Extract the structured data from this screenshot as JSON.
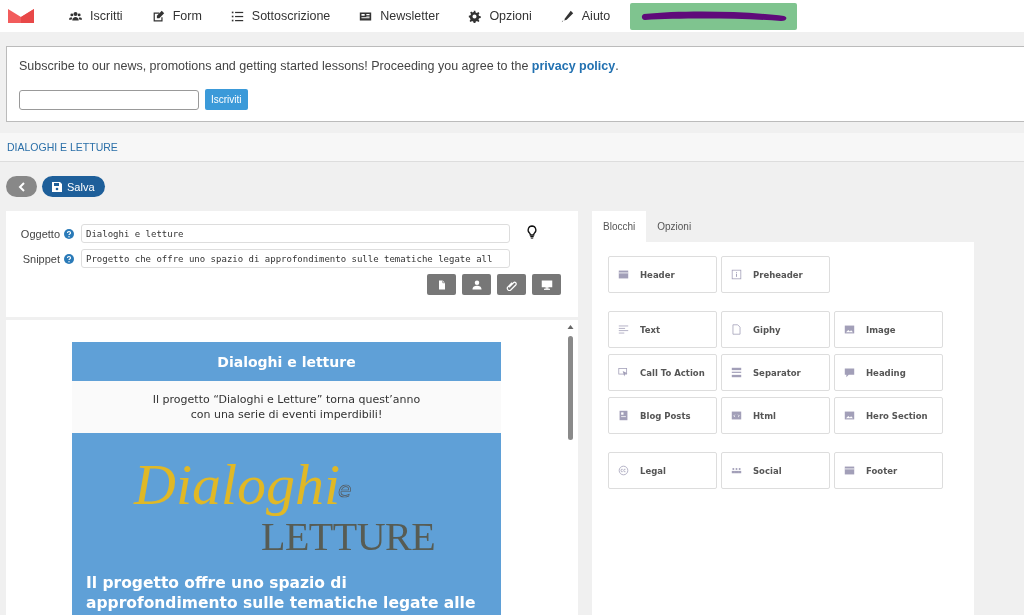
{
  "nav": {
    "items": [
      {
        "label": "Iscritti",
        "kind": "users"
      },
      {
        "label": "Form",
        "kind": "edit"
      },
      {
        "label": "Sottoscrizione",
        "kind": "list"
      },
      {
        "label": "Newsletter",
        "kind": "newspaper"
      },
      {
        "label": "Opzioni",
        "kind": "gear"
      },
      {
        "label": "Aiuto",
        "kind": "pen"
      }
    ]
  },
  "subscribe": {
    "text": "Subscribe to our news, promotions and getting started lessons! Proceeding you agree to the ",
    "link": "privacy policy",
    "tail": ".",
    "button": "Iscriviti"
  },
  "breadcrumb": "DIALOGHI E LETTURE",
  "toolbar": {
    "save": "Salva"
  },
  "form": {
    "fields": [
      {
        "label": "Oggetto",
        "value": "Dialoghi e letture"
      },
      {
        "label": "Snippet",
        "value": "Progetto che offre uno spazio di approfondimento sulle tematiche legate all"
      }
    ],
    "tools": [
      {
        "kind": "file"
      },
      {
        "kind": "user"
      },
      {
        "kind": "paperclip"
      },
      {
        "kind": "desktop"
      }
    ]
  },
  "preview": {
    "title": "Dialoghi e letture",
    "intro": [
      "Il progetto “Dialoghi e Letture” torna quest’anno",
      "con una serie di eventi imperdibili!"
    ],
    "logo": {
      "script": "Dialoghi",
      "e": "e",
      "caps": "LETTURE"
    },
    "body": "Il progetto offre uno spazio di approfondimento sulle tematiche legate alle"
  },
  "tabs": [
    {
      "label": "Blocchi",
      "selected": true
    },
    {
      "label": "Opzioni",
      "selected": false
    }
  ],
  "block_groups": [
    [
      {
        "label": "Header",
        "kind": "header"
      },
      {
        "label": "Preheader",
        "kind": "info"
      }
    ],
    [
      {
        "label": "Text",
        "kind": "text"
      },
      {
        "label": "Giphy",
        "kind": "file"
      },
      {
        "label": "Image",
        "kind": "image"
      },
      {
        "label": "Call To Action",
        "kind": "cursor"
      },
      {
        "label": "Separator",
        "kind": "separator"
      },
      {
        "label": "Heading",
        "kind": "chat"
      },
      {
        "label": "Blog Posts",
        "kind": "post"
      },
      {
        "label": "Html",
        "kind": "code"
      },
      {
        "label": "Hero Section",
        "kind": "image"
      }
    ],
    [
      {
        "label": "Legal",
        "kind": "cc"
      },
      {
        "label": "Social",
        "kind": "social"
      },
      {
        "label": "Footer",
        "kind": "header"
      }
    ]
  ]
}
